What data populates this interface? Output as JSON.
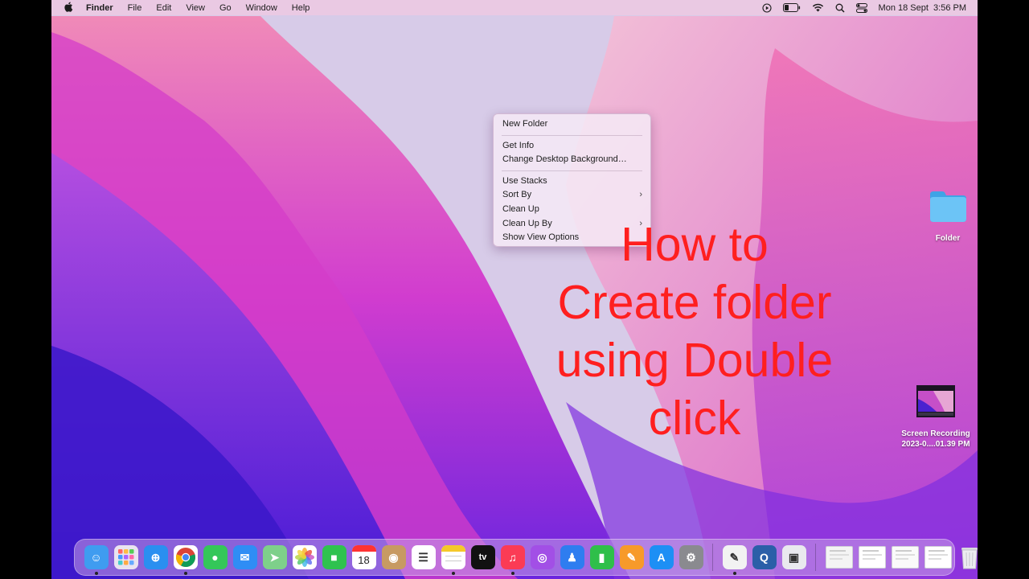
{
  "menubar": {
    "apple_icon": "apple-icon",
    "app_name": "Finder",
    "menus": [
      "File",
      "Edit",
      "View",
      "Go",
      "Window",
      "Help"
    ],
    "status_icons": [
      "play-icon",
      "battery-icon",
      "wifi-icon",
      "spotlight-search-icon",
      "control-center-icon"
    ],
    "datetime": "Mon 18 Sept  3:56 PM"
  },
  "context_menu": {
    "groups": [
      [
        {
          "label": "New Folder",
          "submenu": false
        }
      ],
      [
        {
          "label": "Get Info",
          "submenu": false
        },
        {
          "label": "Change Desktop Background…",
          "submenu": false
        }
      ],
      [
        {
          "label": "Use Stacks",
          "submenu": false
        },
        {
          "label": "Sort By",
          "submenu": true
        },
        {
          "label": "Clean Up",
          "submenu": false
        },
        {
          "label": "Clean Up By",
          "submenu": true
        },
        {
          "label": "Show View Options",
          "submenu": false
        }
      ]
    ],
    "chevron": "›"
  },
  "overlay_text": [
    "How to",
    "Create folder",
    "using Double",
    "click"
  ],
  "desktop_icons": {
    "folder": {
      "label": "Folder",
      "color": "#5ab8f0"
    },
    "recording": {
      "label_line1": "Screen Recording",
      "label_line2": "2023-0....01.39 PM"
    }
  },
  "dock": {
    "apps": [
      {
        "name": "Finder",
        "icon": "finder-icon",
        "color": "#3f9cf0",
        "glyph": "☺",
        "running": true
      },
      {
        "name": "Launchpad",
        "icon": "launchpad-icon",
        "color": "#e9e3f0",
        "glyph": "",
        "running": false
      },
      {
        "name": "Safari",
        "icon": "safari-icon",
        "color": "#2a8ff0",
        "glyph": "⊕",
        "running": false
      },
      {
        "name": "Chrome",
        "icon": "chrome-icon",
        "color": "#ffffff",
        "glyph": "",
        "running": true
      },
      {
        "name": "Messages",
        "icon": "messages-icon",
        "color": "#34c759",
        "glyph": "●",
        "running": false
      },
      {
        "name": "Mail",
        "icon": "mail-icon",
        "color": "#2f8df5",
        "glyph": "✉",
        "running": false
      },
      {
        "name": "Maps",
        "icon": "maps-icon",
        "color": "#7ed08a",
        "glyph": "➤",
        "running": false
      },
      {
        "name": "Photos",
        "icon": "photos-icon",
        "color": "#ffffff",
        "glyph": "✿",
        "running": false
      },
      {
        "name": "FaceTime",
        "icon": "facetime-icon",
        "color": "#2fc24f",
        "glyph": "■",
        "running": false
      },
      {
        "name": "Calendar",
        "icon": "calendar-icon",
        "color": "#ffffff",
        "glyph": "18",
        "running": false
      },
      {
        "name": "Contacts",
        "icon": "contacts-icon",
        "color": "#c79a62",
        "glyph": "◉",
        "running": false
      },
      {
        "name": "Reminders",
        "icon": "reminders-icon",
        "color": "#ffffff",
        "glyph": "☰",
        "running": false
      },
      {
        "name": "Notes",
        "icon": "notes-icon",
        "color": "#fbe27a",
        "glyph": "",
        "running": true
      },
      {
        "name": "Apple TV",
        "icon": "apple-tv-icon",
        "color": "#111111",
        "glyph": "tv",
        "running": false
      },
      {
        "name": "Music",
        "icon": "music-icon",
        "color": "#fb3b55",
        "glyph": "♫",
        "running": true
      },
      {
        "name": "Podcasts",
        "icon": "podcasts-icon",
        "color": "#a24fe6",
        "glyph": "◎",
        "running": false
      },
      {
        "name": "Keynote",
        "icon": "keynote-icon",
        "color": "#2e7df0",
        "glyph": "♟",
        "running": false
      },
      {
        "name": "Numbers",
        "icon": "numbers-icon",
        "color": "#2fbf4a",
        "glyph": "▮",
        "running": false
      },
      {
        "name": "Pages",
        "icon": "pages-icon",
        "color": "#f79a2a",
        "glyph": "✎",
        "running": false
      },
      {
        "name": "App Store",
        "icon": "app-store-icon",
        "color": "#1d8ff5",
        "glyph": "A",
        "running": false
      },
      {
        "name": "System Preferences",
        "icon": "system-preferences-icon",
        "color": "#8a8a8f",
        "glyph": "⚙",
        "running": false
      }
    ],
    "apps_right": [
      {
        "name": "TextEdit",
        "icon": "textedit-icon",
        "color": "#f2f2f2",
        "glyph": "✎",
        "running": true
      },
      {
        "name": "QuickTime Player",
        "icon": "quicktime-icon",
        "color": "#2b5fa8",
        "glyph": "Q",
        "running": false
      },
      {
        "name": "Preview",
        "icon": "preview-icon",
        "color": "#e9e9ee",
        "glyph": "▣",
        "running": false
      }
    ],
    "minimized": [
      {
        "name": "Document 1",
        "icon": "document-thumbnail-icon",
        "color": "#f4f4f4"
      },
      {
        "name": "Document 2",
        "icon": "document-thumbnail-icon",
        "color": "#ffffff"
      },
      {
        "name": "Document 3",
        "icon": "document-thumbnail-icon",
        "color": "#fafafa"
      },
      {
        "name": "Document 4",
        "icon": "document-thumbnail-icon",
        "color": "#ffffff"
      }
    ],
    "trash": {
      "name": "Trash",
      "icon": "trash-icon",
      "color": "#e6e6ea"
    }
  }
}
